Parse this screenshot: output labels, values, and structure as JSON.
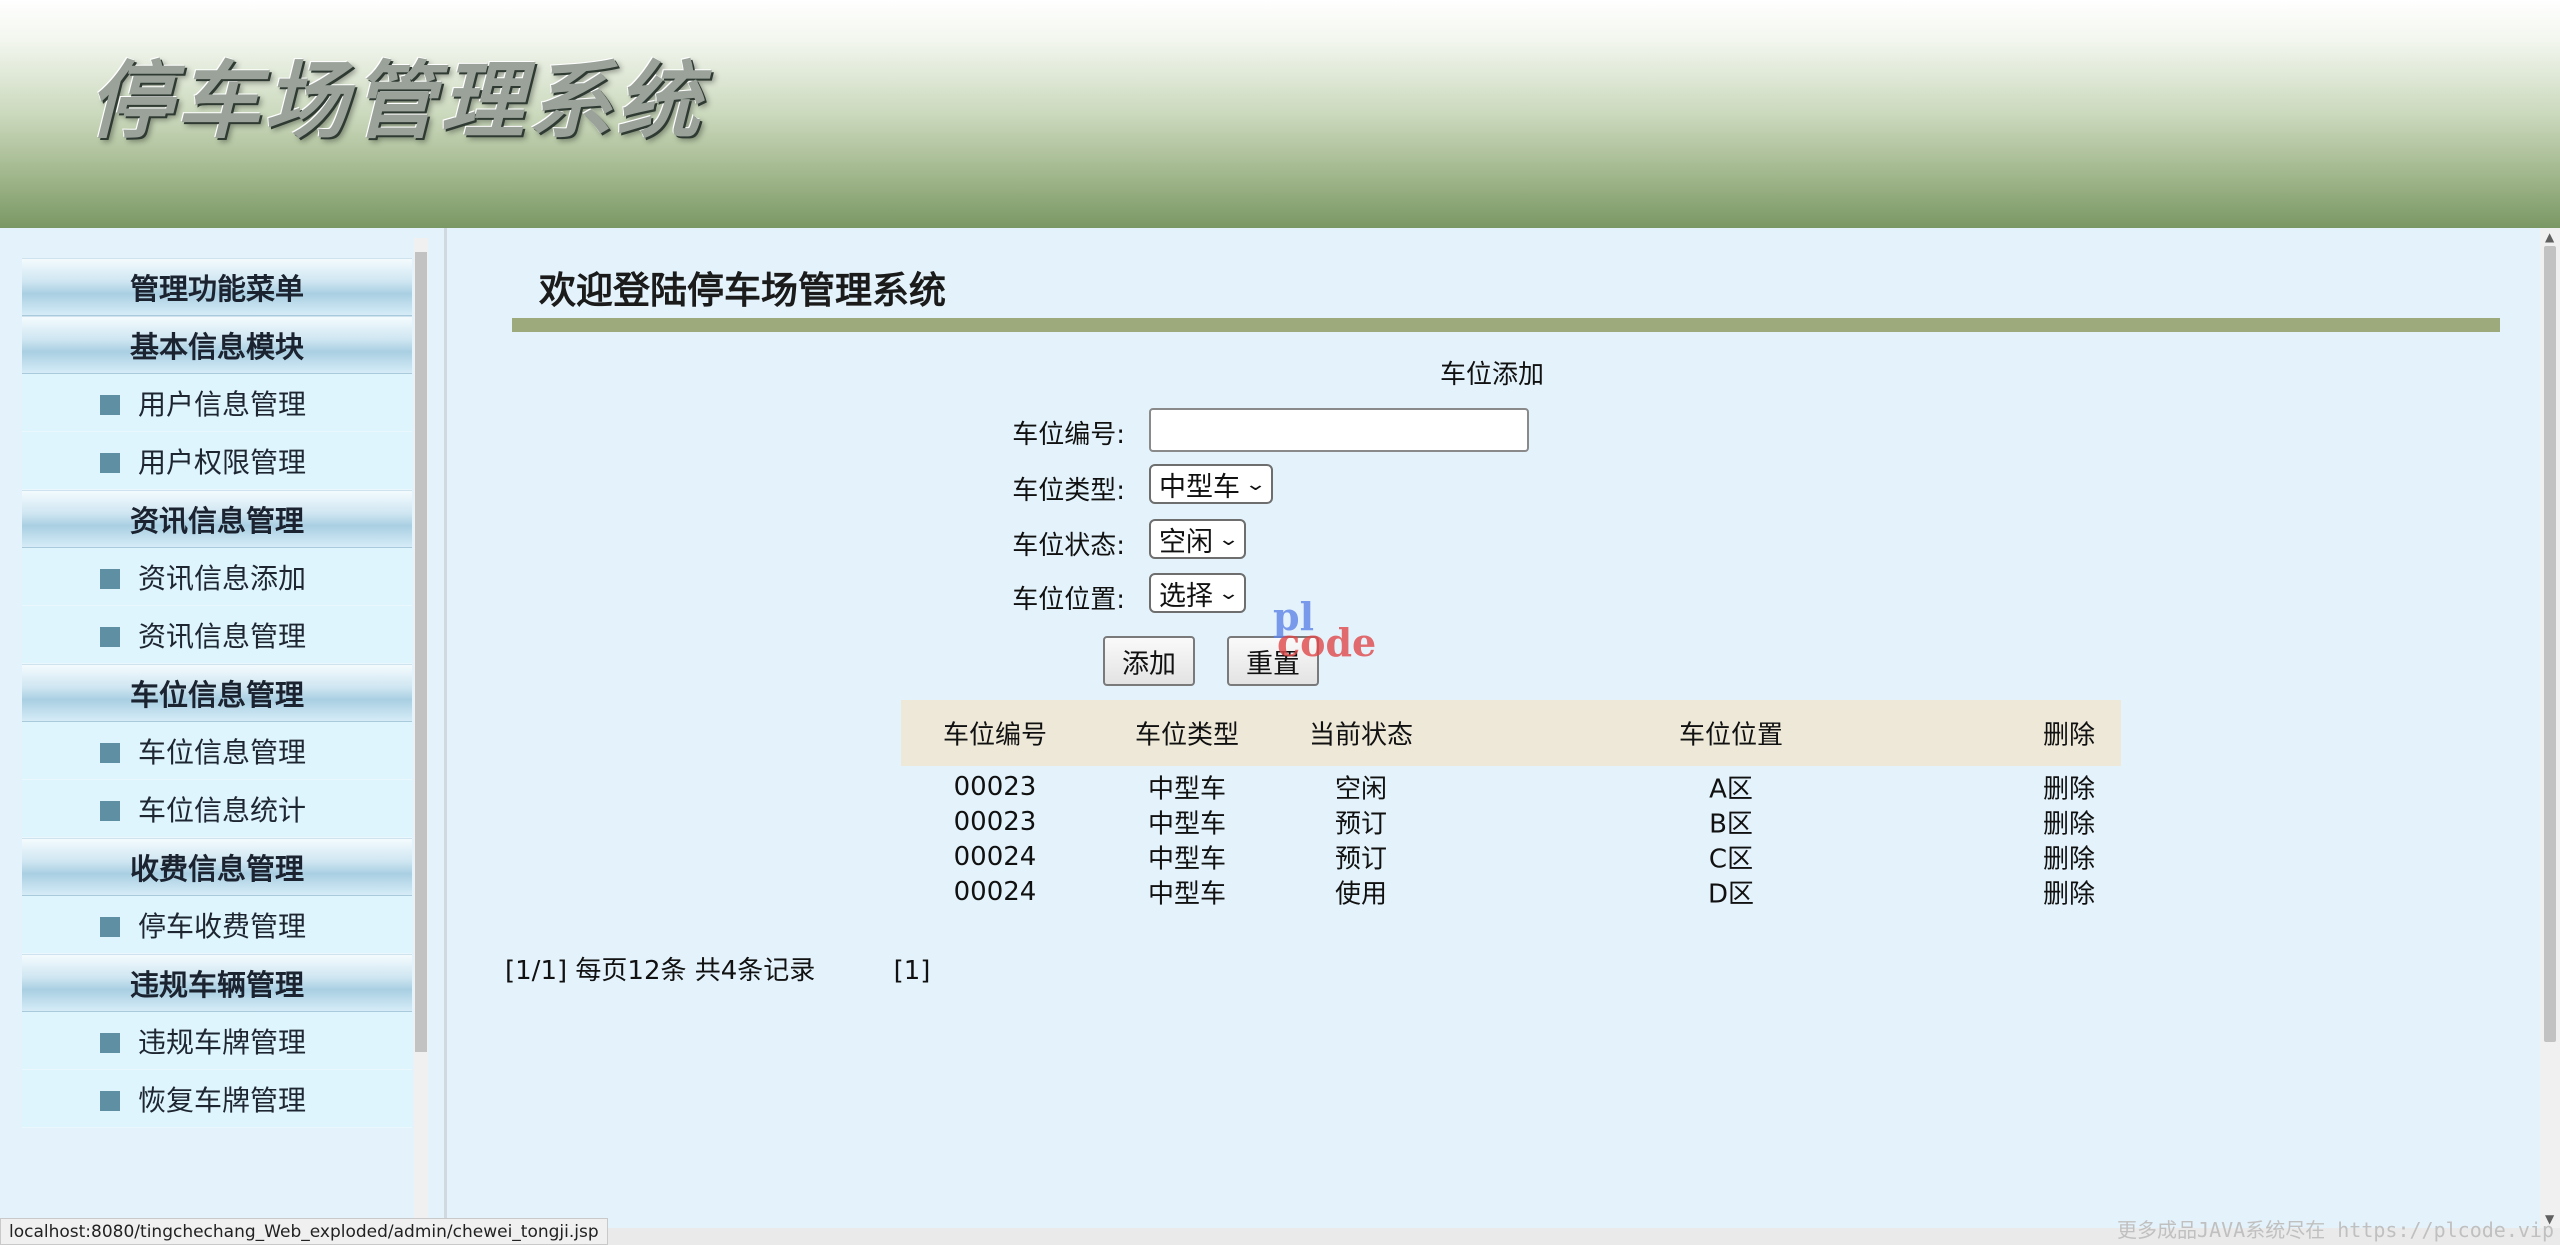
{
  "banner": {
    "title": "停车场管理系统"
  },
  "sidebar": {
    "sections": [
      {
        "title": "管理功能菜单",
        "items": []
      },
      {
        "title": "基本信息模块",
        "items": [
          "用户信息管理",
          "用户权限管理"
        ]
      },
      {
        "title": "资讯信息管理",
        "items": [
          "资讯信息添加",
          "资讯信息管理"
        ]
      },
      {
        "title": "车位信息管理",
        "items": [
          "车位信息管理",
          "车位信息统计"
        ]
      },
      {
        "title": "收费信息管理",
        "items": [
          "停车收费管理"
        ]
      },
      {
        "title": "违规车辆管理",
        "items": [
          "违规车牌管理",
          "恢复车牌管理"
        ]
      }
    ]
  },
  "main": {
    "welcome": "欢迎登陆停车场管理系统",
    "form": {
      "title": "车位添加",
      "number_label": "车位编号:",
      "number_value": "",
      "type_label": "车位类型:",
      "type_value": "中型车",
      "status_label": "车位状态:",
      "status_value": "空闲",
      "location_label": "车位位置:",
      "location_value": "选择",
      "add_label": "添加",
      "reset_label": "重置"
    },
    "table": {
      "headers": [
        "车位编号",
        "车位类型",
        "当前状态",
        "车位位置",
        "删除"
      ],
      "rows": [
        [
          "00023",
          "中型车",
          "空闲",
          "A区",
          "删除"
        ],
        [
          "00023",
          "中型车",
          "预订",
          "B区",
          "删除"
        ],
        [
          "00024",
          "中型车",
          "预订",
          "C区",
          "删除"
        ],
        [
          "00024",
          "中型车",
          "使用",
          "D区",
          "删除"
        ]
      ]
    },
    "pager": {
      "summary": "[1/1] 每页12条 共4条记录",
      "pages": "[1]"
    }
  },
  "watermark": {
    "line1": "pl",
    "line2": "code"
  },
  "status_bar": {
    "url": "localhost:8080/tingchechang_Web_exploded/admin/chewei_tongji.jsp"
  },
  "footer_watermark": "更多成品JAVA系统尽在 https://plcode.vip"
}
